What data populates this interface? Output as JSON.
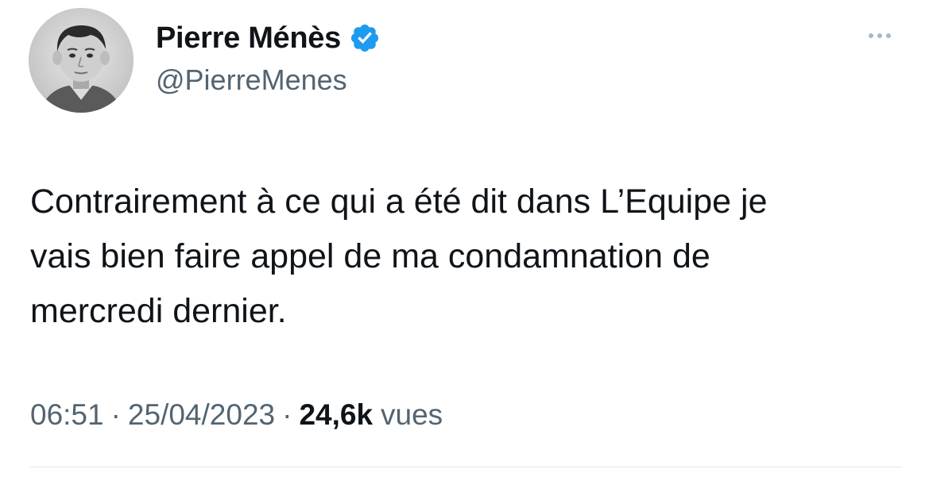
{
  "author": {
    "display_name": "Pierre Ménès",
    "handle": "@PierreMenes",
    "verified": true,
    "verified_color": "#1d9bf0"
  },
  "tweet": {
    "text_lines": [
      "Contrairement à ce qui a été dit dans L’Equipe je",
      "vais bien faire appel de ma condamnation de",
      "mercredi dernier."
    ],
    "time": "06:51",
    "date": "25/04/2023",
    "separator": "·",
    "views_count": "24,6k",
    "views_label": "vues"
  },
  "icons": {
    "verified": "verified-badge-icon",
    "more": "more-options-icon"
  },
  "colors": {
    "text": "#0f1419",
    "secondary": "#536471",
    "divider": "#e3e7ea"
  }
}
